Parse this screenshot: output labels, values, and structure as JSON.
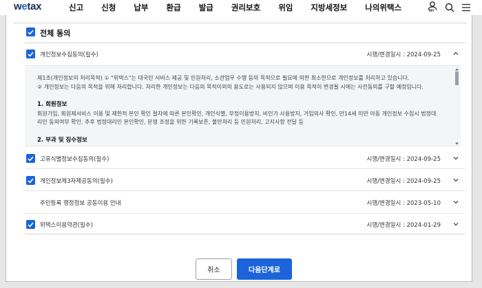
{
  "header": {
    "logo_prefix": "w",
    "logo_o": "e",
    "logo_suffix": "tax",
    "menu": [
      "신고",
      "신청",
      "납부",
      "환급",
      "발급",
      "권리보호",
      "위임",
      "지방세정보",
      "나의위택스"
    ],
    "my_label": "MY"
  },
  "consent": {
    "all_label": "전체 동의",
    "items": [
      {
        "label": "개인정보수집동의(필수)",
        "date": "시행/변경일시 : 2024-09-25",
        "expanded": true,
        "checked": true
      },
      {
        "label": "고유식별정보수집동의(필수)",
        "date": "시행/변경일시 : 2024-09-25",
        "expanded": false,
        "checked": true
      },
      {
        "label": "개인정보제3자제공동의(필수)",
        "date": "시행/변경일시 : 2024-09-25",
        "expanded": false,
        "checked": true
      },
      {
        "label": "주민등록 행정정보 공동이용 안내",
        "date": "시행/변경일시 : 2023-05-10",
        "expanded": false,
        "checked": false
      },
      {
        "label": "위택스이용약관(필수)",
        "date": "시행/변경일시 : 2024-01-29",
        "expanded": false,
        "checked": true
      }
    ],
    "terms": {
      "line1": "제1조(개인정보의 처리목적) ① \"위택스\"는 대국민 서비스 제공 및 민원처리, 소관업무 수행 등의 목적으로 필요에 의한 최소한으로 개인정보를 처리하고 있습니다.",
      "line2": "② 개인정보는 다음의 목적을 위해 처리합니다. 처리한 개인정보는 다음의 목적이외의 용도로는 사용되지 않으며 이용 목적이 변경될 시에는 사전동의를 구할 예정입니다.",
      "section1_title": "1. 회원정보",
      "section1_body1": "회원가입, 회원제서비스 이용 및 제한적 본인 확인 절차에 따른 본인확인, 개인식별, 부정이용방지, 비인가 사용방지, 가입의사 확인, 만14세 미만 아동 개인정보 수집시 법정대",
      "section1_body2": "리인 동의여부 확인, 추후 법정대리인 본인확인, 분쟁 조정을 위한 기록보존, 불만처리 등 민원처리, 고지사항 전달 등",
      "section2_title": "2. 부과 및 징수정보"
    }
  },
  "buttons": {
    "cancel": "취소",
    "next": "다음단계로"
  },
  "colors": {
    "accent": "#1b64da",
    "brand_dark": "#1c2d5a"
  }
}
